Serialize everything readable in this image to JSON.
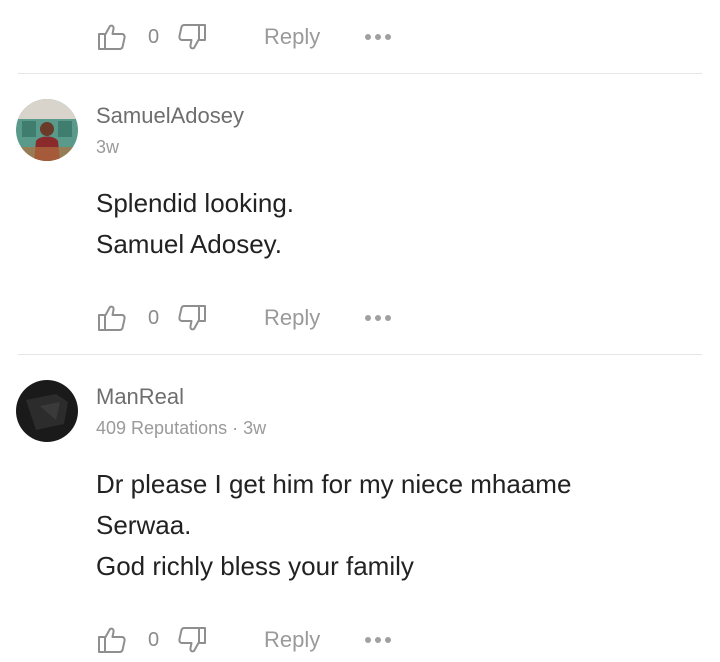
{
  "comments": [
    {
      "actions": {
        "likes": "0",
        "reply_label": "Reply"
      }
    },
    {
      "username": "SamuelAdosey",
      "meta": "3w",
      "lines": [
        "Splendid looking.",
        "Samuel Adosey."
      ],
      "actions": {
        "likes": "0",
        "reply_label": "Reply"
      }
    },
    {
      "username": "ManReal",
      "meta": "409 Reputations · 3w",
      "lines": [
        "Dr please I get him for my niece mhaame",
        "Serwaa.",
        "God richly bless your family"
      ],
      "actions": {
        "likes": "0",
        "reply_label": "Reply"
      }
    }
  ],
  "icons": {
    "like": "thumbs-up-icon",
    "dislike": "thumbs-down-icon",
    "more": "more-options-icon"
  },
  "colors": {
    "text": "#222222",
    "muted": "#9a9a9a",
    "divider": "#e6e6e6"
  }
}
